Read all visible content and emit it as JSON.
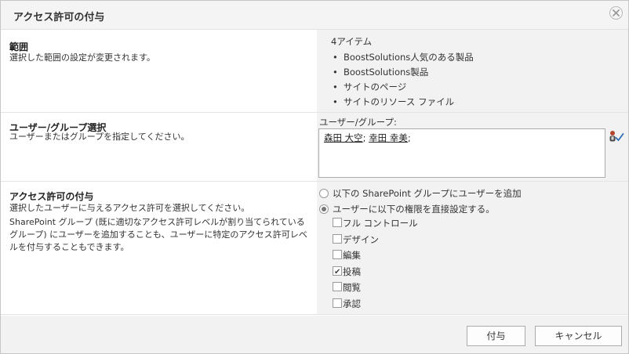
{
  "dialog": {
    "title": "アクセス許可の付与"
  },
  "scope": {
    "title": "範囲",
    "description": "選択した範囲の設定が変更されます。",
    "item_count": "4アイテム",
    "items": [
      "BoostSolutions人気のある製品",
      "BoostSolutions製品",
      "サイトのページ",
      "サイトのリソース ファイル"
    ]
  },
  "user_group": {
    "title": "ユーザー/グループ選択",
    "description": "ユーザーまたはグループを指定してください。",
    "field_label": "ユーザー/グループ:",
    "people": [
      "森田 大空",
      "幸田 幸美"
    ],
    "separator_1": "; ",
    "separator_2": ";"
  },
  "permissions": {
    "title": "アクセス許可の付与",
    "description_1": "選択したユーザーに与えるアクセス許可を選択してください。",
    "description_2": "SharePoint グループ (既に適切なアクセス許可レベルが割り当てられているグループ) にユーザーを追加することも、ユーザーに特定のアクセス許可レベルを付与することもできます。",
    "option_add_group": "以下の SharePoint グループにユーザーを追加",
    "option_direct": "ユーザーに以下の権限を直接設定する。",
    "levels": [
      {
        "label": "フル コントロール",
        "checked": false
      },
      {
        "label": "デザイン",
        "checked": false
      },
      {
        "label": "編集",
        "checked": false
      },
      {
        "label": "投稿",
        "checked": true
      },
      {
        "label": "閲覧",
        "checked": false
      },
      {
        "label": "承認",
        "checked": false
      }
    ]
  },
  "footer": {
    "ok_label": "付与",
    "cancel_label": "キャンセル"
  },
  "icons": {
    "close": "close-icon",
    "check_names": "check-names-icon"
  }
}
